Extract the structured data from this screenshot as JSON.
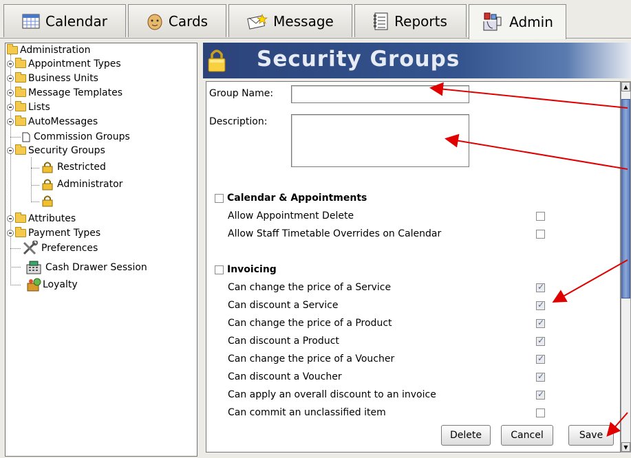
{
  "tabs": [
    {
      "label": "Calendar",
      "icon": "calendar-icon"
    },
    {
      "label": "Cards",
      "icon": "face-icon"
    },
    {
      "label": "Message",
      "icon": "envelope-star-icon"
    },
    {
      "label": "Reports",
      "icon": "notepad-icon"
    },
    {
      "label": "Admin",
      "icon": "admin-tools-icon",
      "active": true
    }
  ],
  "tree": {
    "root": "Administration",
    "items": [
      "Appointment Types",
      "Business Units",
      "Message Templates",
      "Lists",
      "AutoMessages",
      "Commission Groups",
      "Security Groups",
      "Restricted",
      "Administrator",
      "",
      "Attributes",
      "Payment Types",
      "Preferences",
      "Cash Drawer Session",
      "Loyalty"
    ]
  },
  "header": {
    "title": "Security Groups",
    "icon": "padlock-icon"
  },
  "form": {
    "group_name_label": "Group Name:",
    "group_name_value": "",
    "description_label": "Description:",
    "description_value": "",
    "sections": [
      {
        "title": "Calendar & Appointments",
        "checked": false,
        "permissions": [
          {
            "label": "Allow Appointment Delete",
            "checked": false
          },
          {
            "label": "Allow Staff Timetable Overrides on Calendar",
            "checked": false
          }
        ]
      },
      {
        "title": "Invoicing",
        "checked": false,
        "permissions": [
          {
            "label": "Can change the price of a Service",
            "checked": true
          },
          {
            "label": "Can discount a Service",
            "checked": true
          },
          {
            "label": "Can change the price of a Product",
            "checked": true
          },
          {
            "label": "Can discount a Product",
            "checked": true
          },
          {
            "label": "Can change the price of a Voucher",
            "checked": true
          },
          {
            "label": "Can discount a Voucher",
            "checked": true
          },
          {
            "label": "Can apply an overall discount to an invoice",
            "checked": true
          },
          {
            "label": "Can commit an unclassified item",
            "checked": false
          }
        ]
      }
    ]
  },
  "buttons": {
    "delete": "Delete",
    "cancel": "Cancel",
    "save": "Save"
  },
  "colors": {
    "header_bg": "#2c437a",
    "scroll_thumb": "#5c7ec0",
    "annotation_arrow": "#e00000"
  }
}
